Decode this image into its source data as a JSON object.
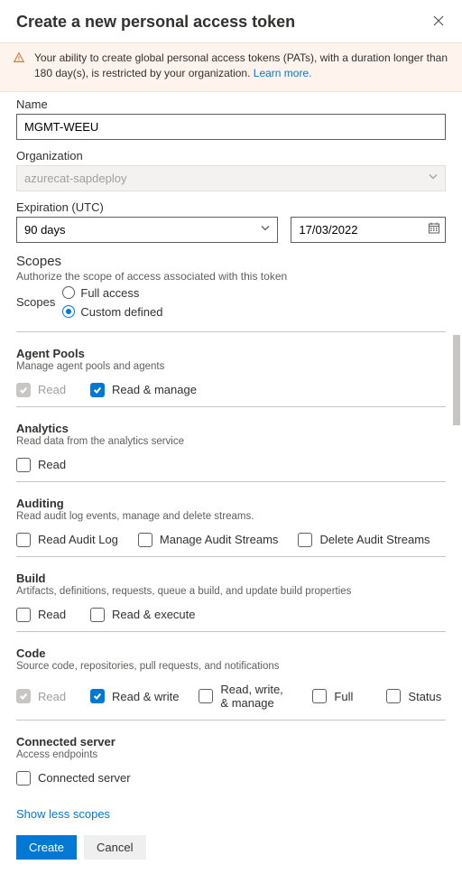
{
  "header": {
    "title": "Create a new personal access token"
  },
  "banner": {
    "text": "Your ability to create global personal access tokens (PATs), with a duration longer than 180 day(s), is restricted by your organization. ",
    "link": "Learn more."
  },
  "fields": {
    "name": {
      "label": "Name",
      "value": "MGMT-WEEU"
    },
    "organization": {
      "label": "Organization",
      "value": "azurecat-sapdeploy"
    },
    "expiration": {
      "label": "Expiration (UTC)",
      "period": "90 days",
      "date": "17/03/2022"
    }
  },
  "scopesSection": {
    "title": "Scopes",
    "subtitle": "Authorize the scope of access associated with this token",
    "label": "Scopes",
    "options": {
      "full": "Full access",
      "custom": "Custom defined"
    }
  },
  "scopes": {
    "agentPools": {
      "title": "Agent Pools",
      "desc": "Manage agent pools and agents",
      "perms": {
        "read": "Read",
        "readManage": "Read & manage"
      }
    },
    "analytics": {
      "title": "Analytics",
      "desc": "Read data from the analytics service",
      "perms": {
        "read": "Read"
      }
    },
    "auditing": {
      "title": "Auditing",
      "desc": "Read audit log events, manage and delete streams.",
      "perms": {
        "readAudit": "Read Audit Log",
        "manage": "Manage Audit Streams",
        "delete": "Delete Audit Streams"
      }
    },
    "build": {
      "title": "Build",
      "desc": "Artifacts, definitions, requests, queue a build, and update build properties",
      "perms": {
        "read": "Read",
        "readExec": "Read & execute"
      }
    },
    "code": {
      "title": "Code",
      "desc": "Source code, repositories, pull requests, and notifications",
      "perms": {
        "read": "Read",
        "readWrite": "Read & write",
        "rwm": "Read, write, & manage",
        "full": "Full",
        "status": "Status"
      }
    },
    "connected": {
      "title": "Connected server",
      "desc": "Access endpoints",
      "perms": {
        "conn": "Connected server"
      }
    }
  },
  "links": {
    "showLess": "Show less scopes"
  },
  "footer": {
    "create": "Create",
    "cancel": "Cancel"
  }
}
